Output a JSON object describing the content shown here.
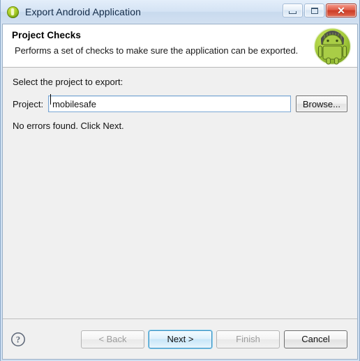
{
  "window": {
    "title": "Export Android Application",
    "title_icon": "export-wizard-icon",
    "controls": {
      "minimize_label": "Minimize",
      "maximize_label": "Maximize",
      "close_label": "Close",
      "close_glyph": "✕"
    }
  },
  "header": {
    "title": "Project Checks",
    "description": "Performs a set of checks to make sure the application can be exported.",
    "icon": "android-robot-icon",
    "icon_colors": {
      "circle_green": "#9ac83c",
      "robot_body": "#a4c93e",
      "robot_outline": "#4f6b16",
      "hair_dark": "#4a4a4a"
    }
  },
  "content": {
    "select_label": "Select the project to export:",
    "project_label": "Project:",
    "project_value": "mobilesafe",
    "project_placeholder": "",
    "browse_label": "Browse...",
    "status_text": "No errors found. Click Next."
  },
  "footer": {
    "help_icon": "help-question-icon",
    "buttons": [
      {
        "id": "back",
        "label": "< Back",
        "enabled": false,
        "default": false
      },
      {
        "id": "next",
        "label": "Next >",
        "enabled": true,
        "default": true
      },
      {
        "id": "finish",
        "label": "Finish",
        "enabled": false,
        "default": false
      },
      {
        "id": "cancel",
        "label": "Cancel",
        "enabled": true,
        "default": false
      }
    ]
  },
  "colors": {
    "titlebar": "#d2e0f1",
    "dialog_bg": "#f0f0f0",
    "header_bg": "#ffffff",
    "accent_blue": "#3c8fc0",
    "close_red": "#cc3c26",
    "android_green": "#9ac83c"
  }
}
